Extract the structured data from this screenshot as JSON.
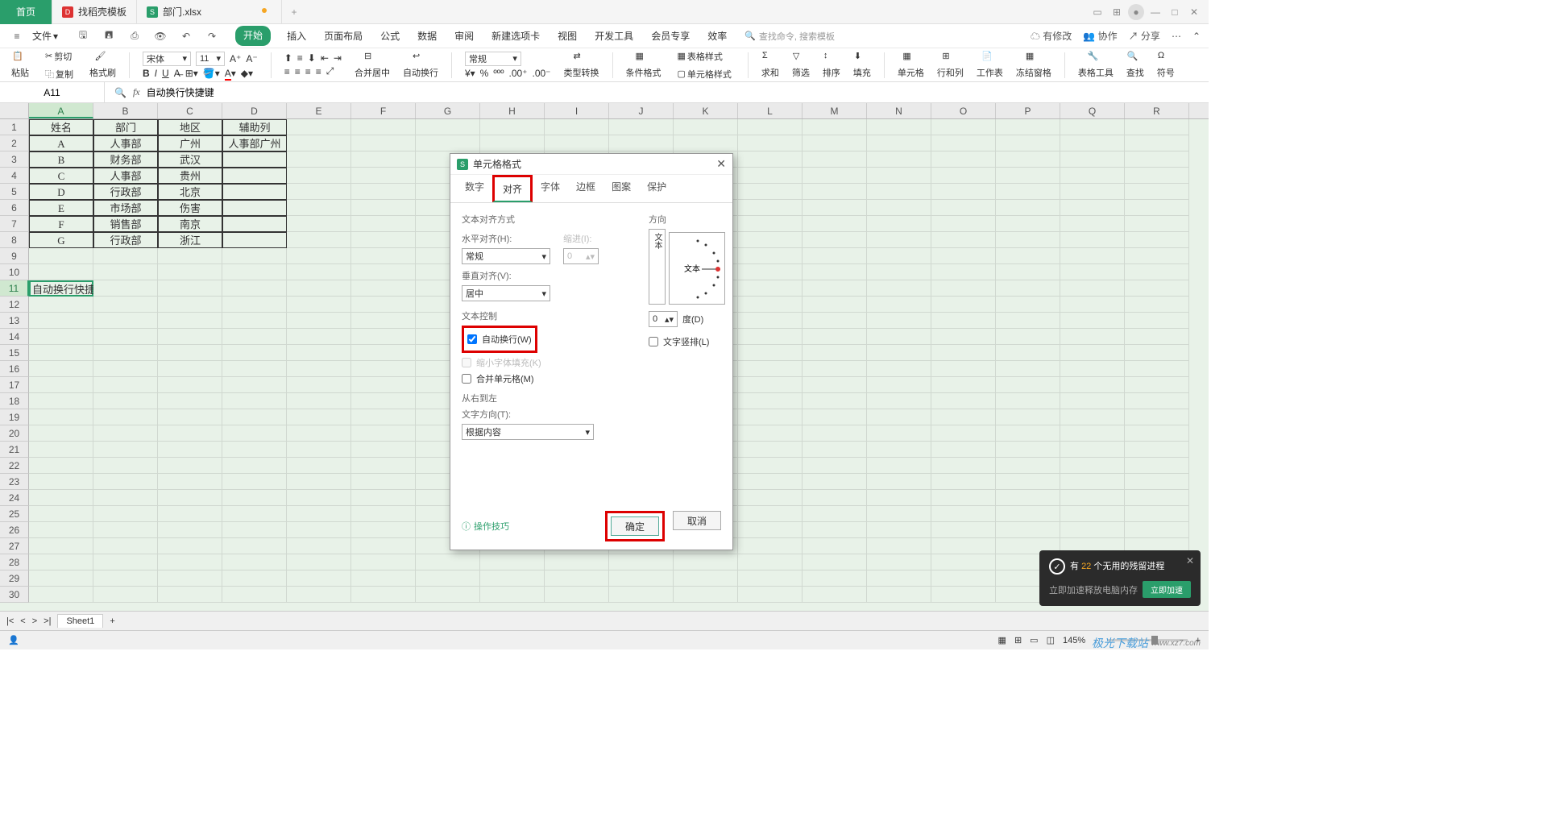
{
  "titlebar": {
    "home_tab": "首页",
    "template_tab": "找稻壳模板",
    "file_tab": "部门.xlsx"
  },
  "menubar": {
    "file": "文件",
    "tabs": [
      "开始",
      "插入",
      "页面布局",
      "公式",
      "数据",
      "审阅",
      "新建选项卡",
      "视图",
      "开发工具",
      "会员专享",
      "效率"
    ],
    "active_tab": "开始",
    "search_placeholder": "查找命令, 搜索模板",
    "unsaved": "有修改",
    "coop": "协作",
    "share": "分享"
  },
  "ribbon": {
    "paste": "粘贴",
    "cut": "剪切",
    "copy": "复制",
    "format_painter": "格式刷",
    "font_name": "宋体",
    "font_size": "11",
    "merge": "合并居中",
    "wrap": "自动换行",
    "number_format": "常规",
    "type_convert": "类型转换",
    "cond_format": "条件格式",
    "table_style": "表格样式",
    "cell_style": "单元格样式",
    "sum": "求和",
    "filter": "筛选",
    "sort": "排序",
    "fill": "填充",
    "cell": "单元格",
    "rowcol": "行和列",
    "worksheet": "工作表",
    "freeze": "冻结窗格",
    "tools": "表格工具",
    "find": "查找",
    "symbol": "符号"
  },
  "namebox": "A11",
  "formula": "自动换行快捷键",
  "columns": [
    "A",
    "B",
    "C",
    "D",
    "E",
    "F",
    "G",
    "H",
    "I",
    "J",
    "K",
    "L",
    "M",
    "N",
    "O",
    "P",
    "Q",
    "R"
  ],
  "rows_count": 30,
  "table": {
    "head": [
      "姓名",
      "部门",
      "地区",
      "辅助列"
    ],
    "data": [
      [
        "A",
        "人事部",
        "广州",
        "人事部广州"
      ],
      [
        "B",
        "财务部",
        "武汉",
        ""
      ],
      [
        "C",
        "人事部",
        "贵州",
        ""
      ],
      [
        "D",
        "行政部",
        "北京",
        ""
      ],
      [
        "E",
        "市场部",
        "伤害",
        ""
      ],
      [
        "F",
        "销售部",
        "南京",
        ""
      ],
      [
        "G",
        "行政部",
        "浙江",
        ""
      ]
    ]
  },
  "active_cell_text": "自动换行快捷键",
  "dialog": {
    "title": "单元格格式",
    "tabs": [
      "数字",
      "对齐",
      "字体",
      "边框",
      "图案",
      "保护"
    ],
    "active_tab": "对齐",
    "text_align_label": "文本对齐方式",
    "h_align_label": "水平对齐(H):",
    "h_align_value": "常规",
    "indent_label": "缩进(I):",
    "indent_value": "0",
    "v_align_label": "垂直对齐(V):",
    "v_align_value": "居中",
    "text_control_label": "文本控制",
    "wrap_label": "自动换行(W)",
    "shrink_label": "缩小字体填充(K)",
    "merge_label": "合并单元格(M)",
    "rtl_label": "从右到左",
    "text_dir_label": "文字方向(T):",
    "text_dir_value": "根据内容",
    "orient_label": "方向",
    "orient_text": "文本",
    "degree_label": "度(D)",
    "degree_value": "0",
    "vertical_text_label": "文字竖排(L)",
    "tips": "操作技巧",
    "ok": "确定",
    "cancel": "取消"
  },
  "sheet": {
    "name": "Sheet1"
  },
  "statusbar": {
    "zoom": "145%"
  },
  "toast": {
    "title_prefix": "有 ",
    "title_count": "22",
    "title_suffix": " 个无用的残留进程",
    "desc": "立即加速释放电脑内存",
    "action": "立即加速"
  },
  "watermark": {
    "brand": "极光下载站",
    "url": "www.xz7.com"
  }
}
